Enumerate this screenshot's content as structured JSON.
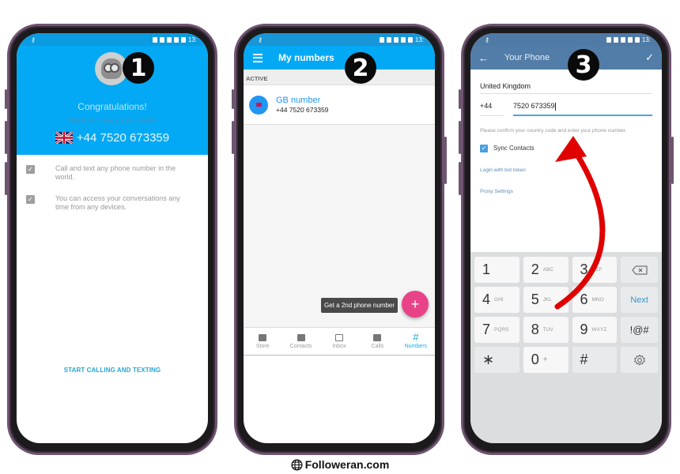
{
  "status_bar": {
    "time": "13:"
  },
  "phone1": {
    "step": "1",
    "congrats": "Congratulations!",
    "subtitle": "This is your new phone number",
    "phone_number": "+44 7520 673359",
    "features": [
      {
        "text": "Call and text any phone number in the world."
      },
      {
        "text": "You can access your conversations any time from any devices."
      }
    ],
    "cta": "START CALLING AND TEXTING"
  },
  "phone2": {
    "step": "2",
    "title": "My numbers",
    "section": "ACTIVE",
    "item": {
      "name": "GB number",
      "number": "+44 7520 673359"
    },
    "tooltip": "Get a 2nd phone number",
    "fab": "+",
    "tabs": [
      {
        "label": "Store",
        "icon": "store-icon"
      },
      {
        "label": "Contacts",
        "icon": "contacts-icon"
      },
      {
        "label": "Inbox",
        "icon": "inbox-icon"
      },
      {
        "label": "Calls",
        "icon": "calls-icon"
      },
      {
        "label": "Numbers",
        "icon": "hash-icon",
        "glyph": "#",
        "active": true
      }
    ]
  },
  "phone3": {
    "step": "3",
    "title": "Your Phone",
    "country": "United Kingdom",
    "country_code": "+44",
    "phone_value": "7520 673359",
    "hint": "Please confirm your country code and enter your phone number.",
    "sync_contacts": "Sync Contacts",
    "sync_checked": true,
    "link_bot": "Login with bot token",
    "link_proxy": "Proxy Settings",
    "keypad": {
      "rows": [
        [
          {
            "d": "1",
            "l": ""
          },
          {
            "d": "2",
            "l": "ABC"
          },
          {
            "d": "3",
            "l": "DEF"
          }
        ],
        [
          {
            "d": "4",
            "l": "GHI"
          },
          {
            "d": "5",
            "l": "JKL"
          },
          {
            "d": "6",
            "l": "MNO"
          }
        ],
        [
          {
            "d": "7",
            "l": "PQRS"
          },
          {
            "d": "8",
            "l": "TUV"
          },
          {
            "d": "9",
            "l": "WXYZ"
          }
        ]
      ],
      "next": "Next",
      "symbols": "!@#",
      "star": "∗",
      "zero": "0",
      "zero_sub": "+",
      "hash": "#"
    }
  },
  "footer": {
    "brand": "Followeran.com"
  },
  "colors": {
    "app_blue": "#03a9f4",
    "telegram_blue": "#527da8",
    "fab_pink": "#e84388",
    "arrow_red": "#e00000"
  }
}
